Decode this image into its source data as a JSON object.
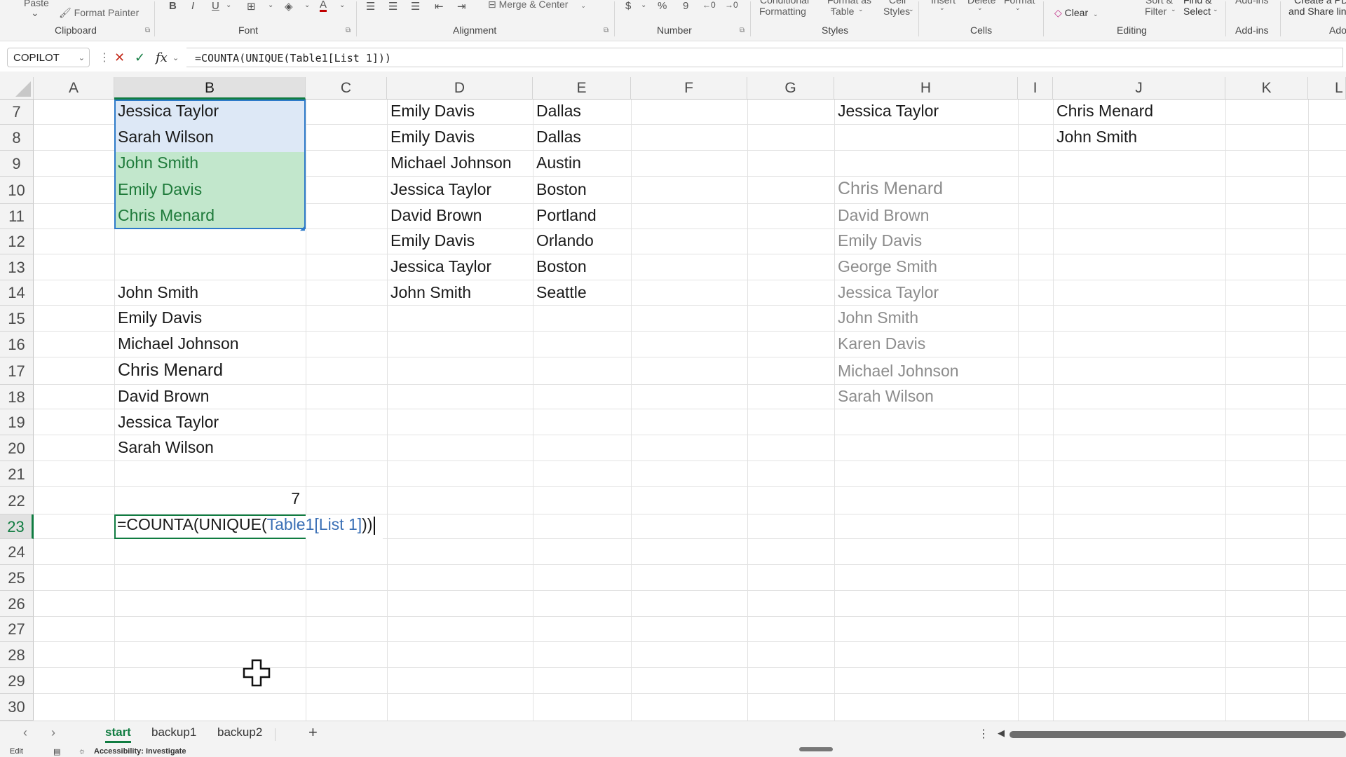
{
  "ribbon": {
    "clipboard": {
      "paste": "Paste",
      "format_painter": "Format Painter",
      "group": "Clipboard"
    },
    "font": {
      "bold": "B",
      "italic": "I",
      "underline": "U",
      "font_color": "A",
      "group": "Font"
    },
    "alignment": {
      "merge_center": "Merge & Center",
      "group": "Alignment"
    },
    "number": {
      "currency": "$",
      "percent": "%",
      "comma": "9",
      "inc_decimal": "←0",
      "dec_decimal": "→0",
      "group": "Number"
    },
    "styles": {
      "conditional": "Conditional",
      "conditional_2": "Formatting",
      "format_as": "Format as",
      "format_as_2": "Table",
      "cell": "Cell",
      "cell_2": "Styles",
      "group": "Styles"
    },
    "cells": {
      "insert": "Insert",
      "delete": "Delete",
      "format": "Format",
      "group": "Cells"
    },
    "editing": {
      "clear": "Clear",
      "sort": "Sort &",
      "sort_2": "Filter",
      "find": "Find &",
      "find_2": "Select",
      "group": "Editing"
    },
    "addins": {
      "label": "Add-ins",
      "group": "Add-ins"
    },
    "share": {
      "line1": "Create a PDF",
      "line2": "and Share link",
      "group": "Adobe"
    }
  },
  "formula_bar": {
    "name_box": "COPILOT",
    "cancel": "✕",
    "enter": "✓",
    "fx": "fx",
    "formula": "=COUNTA(UNIQUE(Table1[List 1]))"
  },
  "columns": [
    "A",
    "B",
    "C",
    "D",
    "E",
    "F",
    "G",
    "H",
    "I",
    "J",
    "K",
    "L"
  ],
  "rows": [
    "7",
    "8",
    "9",
    "10",
    "11",
    "12",
    "13",
    "14",
    "15",
    "16",
    "17",
    "18",
    "19",
    "20",
    "21",
    "22",
    "23",
    "24",
    "25",
    "26",
    "27",
    "28",
    "29",
    "30"
  ],
  "colB": {
    "r7": "Jessica Taylor",
    "r8": "Sarah Wilson",
    "r9": "John Smith",
    "r10": "Emily Davis",
    "r11": "Chris Menard",
    "r14": "John Smith",
    "r15": "Emily Davis",
    "r16": "Michael Johnson",
    "r17": "Chris Menard",
    "r18": "David Brown",
    "r19": "Jessica Taylor",
    "r20": "Sarah Wilson",
    "r22": "7"
  },
  "colD": [
    "Emily Davis",
    "Emily Davis",
    "Michael Johnson",
    "Jessica Taylor",
    "David Brown",
    "Emily Davis",
    "Jessica Taylor",
    "John Smith"
  ],
  "colE": [
    "Dallas",
    "Dallas",
    "Austin",
    "Boston",
    "Portland",
    "Orlando",
    "Boston",
    "Seattle"
  ],
  "colH": {
    "r7": "Jessica Taylor",
    "spill": [
      "Chris Menard",
      "David Brown",
      "Emily Davis",
      "George Smith",
      "Jessica Taylor",
      "John Smith",
      "Karen Davis",
      "Michael Johnson",
      "Sarah Wilson"
    ]
  },
  "colJ": [
    "Chris Menard",
    "John Smith"
  ],
  "editing_cell": {
    "part1": "=COUNTA(UNIQUE(",
    "ref": "Table1[List 1]",
    "part2": "))"
  },
  "sheets": {
    "active": "start",
    "tab2": "backup1",
    "tab3": "backup2",
    "add": "+"
  },
  "status": {
    "mode": "Edit",
    "accessibility": "Accessibility: Investigate"
  },
  "colors": {
    "accent": "#107c41",
    "selection_blue": "#2d7ac9",
    "unique_green": "#1e7a3a",
    "spill_gray": "#8c8c8c"
  }
}
